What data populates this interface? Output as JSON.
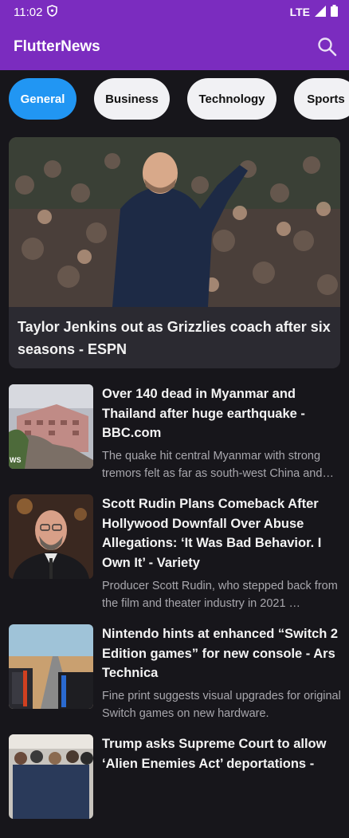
{
  "status": {
    "time": "11:02",
    "network": "LTE"
  },
  "app": {
    "title": "FlutterNews"
  },
  "categories": [
    "General",
    "Business",
    "Technology",
    "Sports"
  ],
  "hero": {
    "title": "Taylor Jenkins out as Grizzlies coach after six seasons - ESPN"
  },
  "articles": [
    {
      "title": "Over 140 dead in Myanmar and Thailand after huge earthquake - BBC.com",
      "description": "The quake hit central Myanmar with strong tremors felt as far as south-west China and Thailand.",
      "thumb_badge": "WS"
    },
    {
      "title": "Scott Rudin Plans Comeback After Hollywood Downfall Over Abuse Allegations: ‘It Was Bad Behavior. I Own It’ - Variety",
      "description": "Producer Scott Rudin, who stepped back from the film and theater industry in 2021 …"
    },
    {
      "title": "Nintendo hints at enhanced “Switch 2 Edition games” for new console - Ars Technica",
      "description": "Fine print suggests visual upgrades for original Switch games on new hardware."
    },
    {
      "title": "Trump asks Supreme Court to allow ‘Alien Enemies Act’ deportations - ",
      "description": ""
    }
  ],
  "colors": {
    "appbar": "#7b2cbf",
    "chip_active": "#2196f3",
    "background": "#17161b",
    "card": "#2b2a31"
  }
}
